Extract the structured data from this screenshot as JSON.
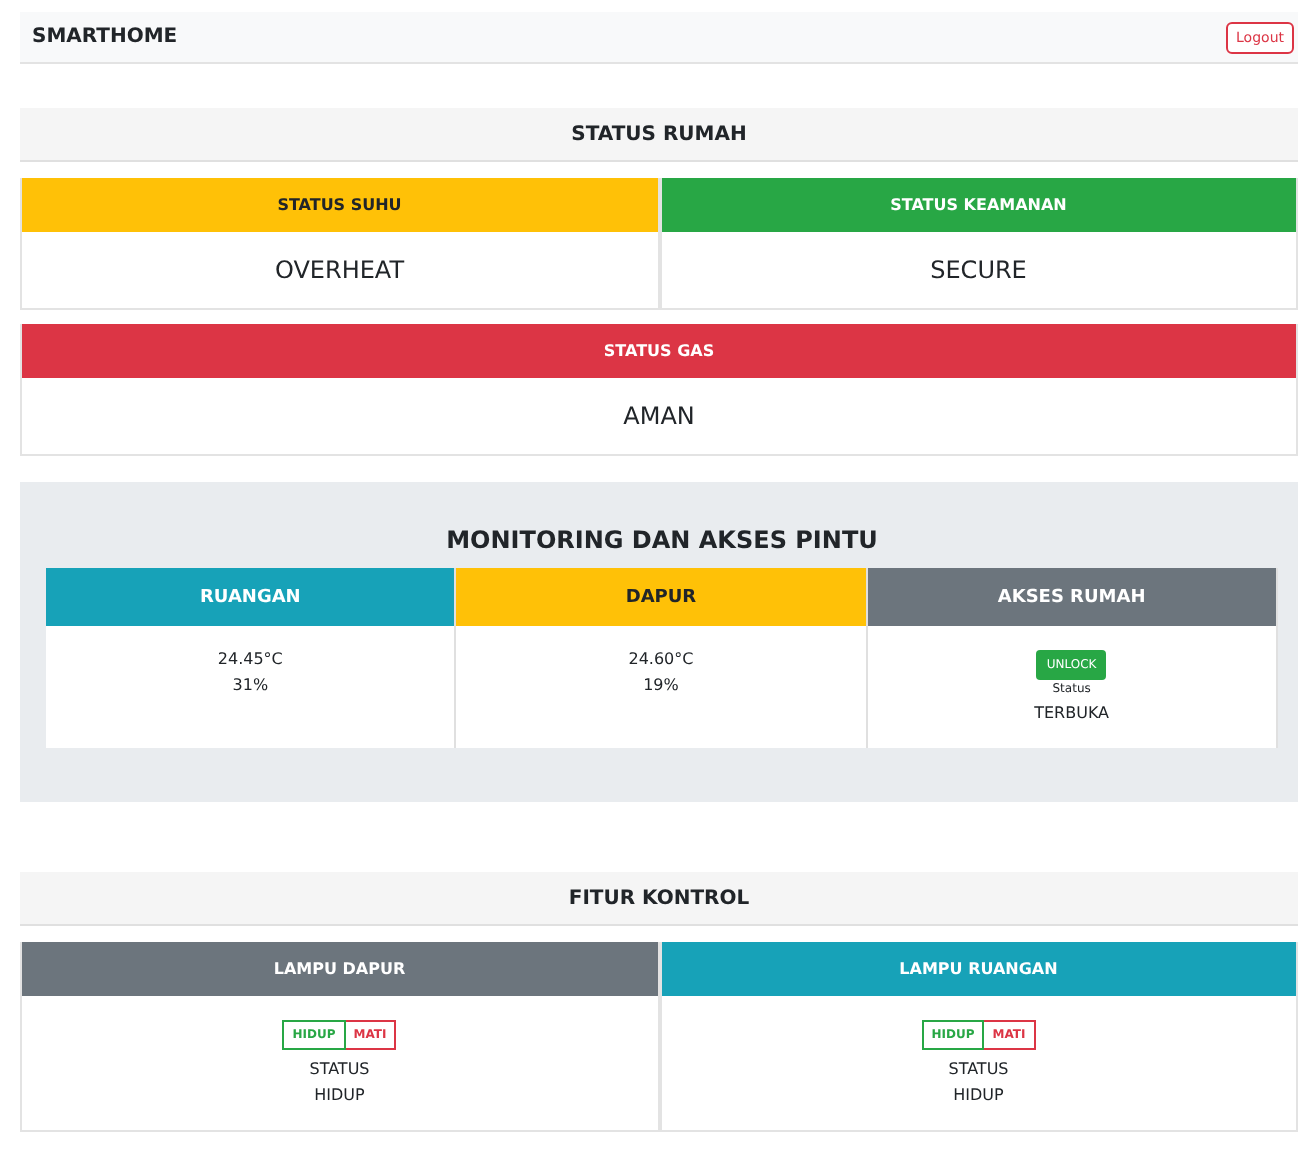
{
  "navbar": {
    "brand": "SMARTHOME",
    "logout": "Logout"
  },
  "status_section": {
    "title": "STATUS RUMAH",
    "cards": [
      {
        "title": "STATUS SUHU",
        "color": "#ffc107",
        "value": "OVERHEAT"
      },
      {
        "title": "STATUS KEAMANAN",
        "color": "#28a745",
        "value": "SECURE"
      }
    ],
    "gas_card": {
      "title": "STATUS GAS",
      "color": "#dc3545",
      "value": "AMAN"
    }
  },
  "monitoring": {
    "title": "MONITORING DAN AKSES PINTU",
    "columns": [
      {
        "kind": "sensor",
        "title": "RUANGAN",
        "color": "#17a2b8",
        "temperature": "24.45°C",
        "humidity": "31%"
      },
      {
        "kind": "sensor",
        "title": "DAPUR",
        "color": "#ffc107",
        "temperature": "24.60°C",
        "humidity": "19%"
      },
      {
        "kind": "access",
        "title": "AKSES RUMAH",
        "color": "#6c757d",
        "button": "UNLOCK",
        "status_label": "Status",
        "status": "TERBUKA"
      }
    ]
  },
  "controls": {
    "title": "FITUR KONTROL",
    "lamps": [
      {
        "title": "LAMPU DAPUR",
        "color": "#6c757d",
        "on_label": "HIDUP",
        "off_label": "MATI",
        "status_label": "STATUS",
        "status": "HIDUP"
      },
      {
        "title": "LAMPU RUANGAN",
        "color": "#17a2b8",
        "on_label": "HIDUP",
        "off_label": "MATI",
        "status_label": "STATUS",
        "status": "HIDUP"
      }
    ]
  }
}
